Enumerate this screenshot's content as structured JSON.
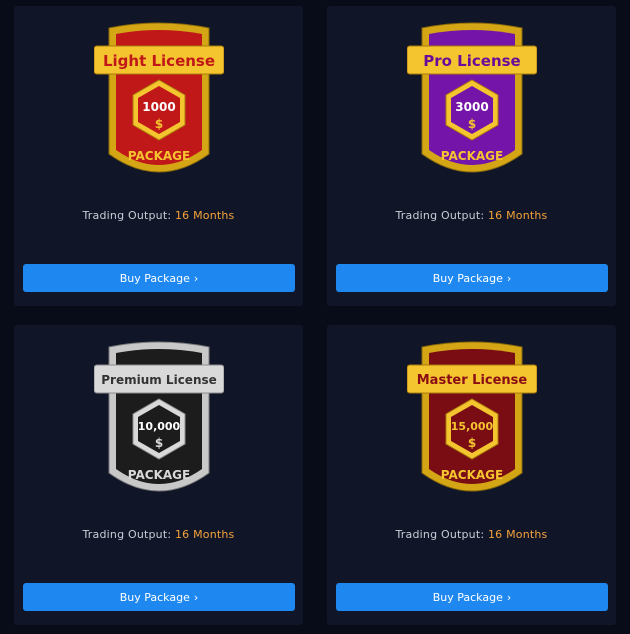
{
  "labels": {
    "output_label": "Trading Output:",
    "buy_label": "Buy Package",
    "chevron": "›"
  },
  "packages": [
    {
      "title": "Light License",
      "amount": "1000",
      "currency": "$",
      "subtitle": "PACKAGE",
      "output_value": "16 Months",
      "theme": "red"
    },
    {
      "title": "Pro License",
      "amount": "3000",
      "currency": "$",
      "subtitle": "PACKAGE",
      "output_value": "16 Months",
      "theme": "purple"
    },
    {
      "title": "Premium License",
      "amount": "10,000",
      "currency": "$",
      "subtitle": "PACKAGE",
      "output_value": "16 Months",
      "theme": "silver"
    },
    {
      "title": "Master License",
      "amount": "15,000",
      "currency": "$",
      "subtitle": "PACKAGE",
      "output_value": "16 Months",
      "theme": "darkred"
    }
  ],
  "colors": {
    "background": "#080b18",
    "card": "#101628",
    "button": "#1e88f0",
    "accent": "#f4a23a"
  }
}
